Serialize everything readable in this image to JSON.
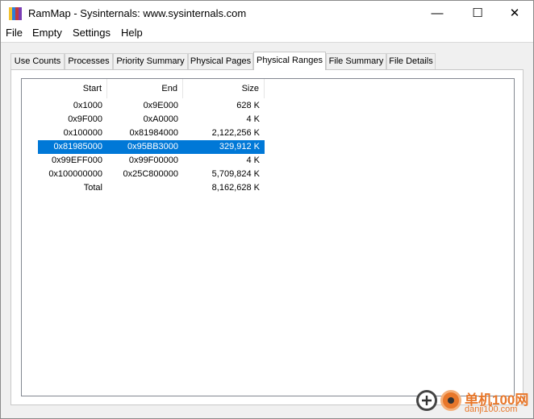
{
  "window": {
    "title": "RamMap - Sysinternals: www.sysinternals.com",
    "icon": "rammap-app-icon",
    "icon_colors": [
      "#f2c230",
      "#2f7fd6",
      "#c23b3b",
      "#7b3fb5"
    ],
    "controls": {
      "minimize": "—",
      "maximize": "☐",
      "close": "✕"
    }
  },
  "menu": [
    "File",
    "Empty",
    "Settings",
    "Help"
  ],
  "tabs": [
    {
      "label": "Use Counts"
    },
    {
      "label": "Processes"
    },
    {
      "label": "Priority Summary"
    },
    {
      "label": "Physical Pages"
    },
    {
      "label": "Physical Ranges",
      "active": true
    },
    {
      "label": "File Summary"
    },
    {
      "label": "File Details"
    }
  ],
  "table": {
    "columns": [
      "Start",
      "End",
      "Size"
    ],
    "rows": [
      {
        "start": "0x1000",
        "end": "0x9E000",
        "size": "628 K"
      },
      {
        "start": "0x9F000",
        "end": "0xA0000",
        "size": "4 K"
      },
      {
        "start": "0x100000",
        "end": "0x81984000",
        "size": "2,122,256 K"
      },
      {
        "start": "0x81985000",
        "end": "0x95BB3000",
        "size": "329,912 K",
        "selected": true
      },
      {
        "start": "0x99EFF000",
        "end": "0x99F00000",
        "size": "4 K"
      },
      {
        "start": "0x100000000",
        "end": "0x25C800000",
        "size": "5,709,824 K"
      },
      {
        "start": "Total",
        "end": "",
        "size": "8,162,628 K"
      }
    ],
    "selection_color": "#0078d7"
  },
  "watermark": {
    "text": "单机100网",
    "url": "danji100.com",
    "color": "#e8772a"
  }
}
